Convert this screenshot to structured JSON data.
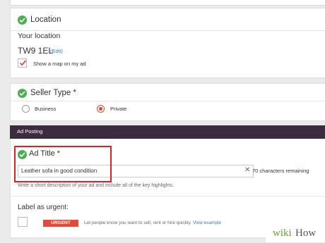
{
  "location": {
    "title": "Location",
    "your_location_label": "Your location",
    "postcode": "TW9 1EL",
    "edit_link": "(Edit)",
    "show_map_label": "Show a map on my ad",
    "show_map_checked": true
  },
  "seller_type": {
    "title": "Seller Type *",
    "options": [
      {
        "label": "Business",
        "selected": false
      },
      {
        "label": "Private",
        "selected": true
      }
    ]
  },
  "ad_posting": {
    "header": "Ad Posting"
  },
  "ad_title": {
    "title": "Ad Title *",
    "value": "Leather sofa in good condition",
    "clear_icon": "x-icon",
    "characters_remaining": "70 characters remaining",
    "help_text": "Write a short description of your ad and include all of the key highlights."
  },
  "urgent": {
    "title": "Label as urgent:",
    "badge": "URGENT",
    "description": "Let people know you want to sell, rent or hire quickly.",
    "view_example_link": "View example"
  },
  "watermark": {
    "brand_prefix": "wiki",
    "brand_suffix": "How"
  },
  "colors": {
    "check_green": "#4caf50",
    "urgent_red": "#e44a3a",
    "highlight_red": "#d9212b",
    "link_blue": "#3b7bbf",
    "dark_header": "#3b2c3f"
  }
}
